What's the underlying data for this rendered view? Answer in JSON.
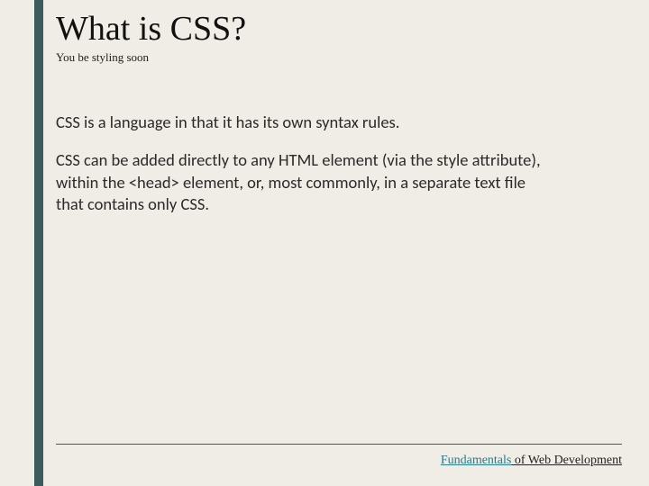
{
  "header": {
    "title": "What is CSS?",
    "subtitle": "You be styling soon"
  },
  "body": {
    "p1": "CSS is a language in that it has its own syntax rules.",
    "p2": "CSS can be added directly to any HTML element (via the style attribute), within the <head> element, or, most commonly, in a separate text file that contains only CSS."
  },
  "footer": {
    "brand": "Fundamentals",
    "rest": " of Web Development"
  }
}
